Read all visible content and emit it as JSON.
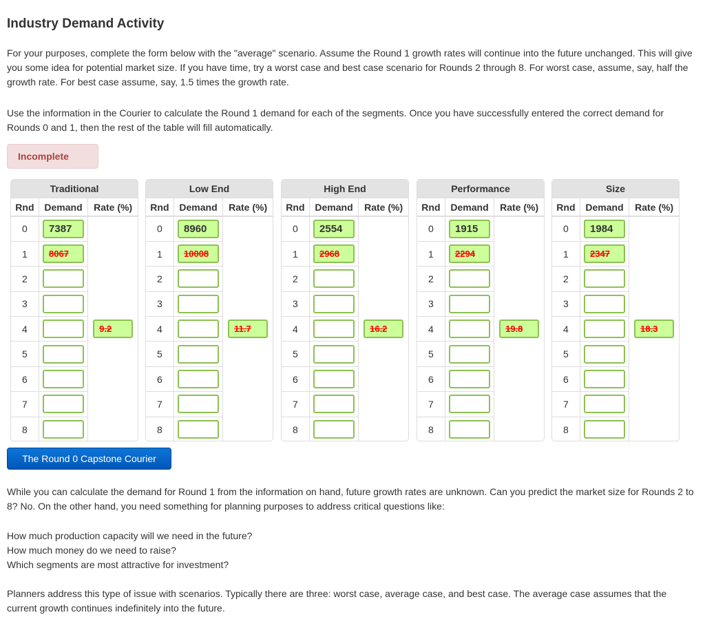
{
  "page": {
    "title": "Industry Demand Activity",
    "intro_paragraphs": [
      "For your purposes, complete the form below with the \"average\" scenario. Assume the Round 1 growth rates will continue into the future unchanged. This will give you some idea for potential market size. If you have time, try a worst case and best case scenario for Rounds 2 through 8. For worst case, assume, say, half the growth rate. For best case assume, say, 1.5 times the growth rate.",
      "Use the information in the Courier to calculate the Round 1 demand for each of the segments. Once you have successfully entered the correct demand for Rounds 0 and 1, then the rest of the table will fill automatically."
    ],
    "status": "Incomplete",
    "courier_button": "The Round 0 Capstone Courier",
    "after_paragraph": "While you can calculate the demand for Round 1 from the information on hand, future growth rates are unknown. Can you predict the market size for Rounds 2 to 8? No. On the other hand, you need something for planning purposes to address critical questions like:",
    "questions": [
      "How much production capacity will we need in the future?",
      "How much money do we need to raise?",
      "Which segments are most attractive for investment?"
    ],
    "closing_paragraph": "Planners address this type of issue with scenarios. Typically there are three: worst case, average case, and best case. The average case assumes that the current growth continues indefinitely into the future."
  },
  "table_headers": {
    "rnd": "Rnd",
    "demand": "Demand",
    "rate": "Rate (%)"
  },
  "colors": {
    "field_border": "#8cc152",
    "field_filled_bg": "#ccff99",
    "wrong_text": "#ff0000",
    "badge_bg": "#f2dede",
    "badge_text": "#a94442",
    "button_bg": "#0a6ad0"
  },
  "segments": [
    {
      "name": "Traditional",
      "rounds": [
        "0",
        "1",
        "2",
        "3",
        "4",
        "5",
        "6",
        "7",
        "8"
      ],
      "demand": [
        "7387",
        "8067",
        "",
        "",
        "",
        "",
        "",
        "",
        ""
      ],
      "rate": "9.2"
    },
    {
      "name": "Low End",
      "rounds": [
        "0",
        "1",
        "2",
        "3",
        "4",
        "5",
        "6",
        "7",
        "8"
      ],
      "demand": [
        "8960",
        "10008",
        "",
        "",
        "",
        "",
        "",
        "",
        ""
      ],
      "rate": "11.7"
    },
    {
      "name": "High End",
      "rounds": [
        "0",
        "1",
        "2",
        "3",
        "4",
        "5",
        "6",
        "7",
        "8"
      ],
      "demand": [
        "2554",
        "2968",
        "",
        "",
        "",
        "",
        "",
        "",
        ""
      ],
      "rate": "16.2"
    },
    {
      "name": "Performance",
      "rounds": [
        "0",
        "1",
        "2",
        "3",
        "4",
        "5",
        "6",
        "7",
        "8"
      ],
      "demand": [
        "1915",
        "2294",
        "",
        "",
        "",
        "",
        "",
        "",
        ""
      ],
      "rate": "19.8"
    },
    {
      "name": "Size",
      "rounds": [
        "0",
        "1",
        "2",
        "3",
        "4",
        "5",
        "6",
        "7",
        "8"
      ],
      "demand": [
        "1984",
        "2347",
        "",
        "",
        "",
        "",
        "",
        "",
        ""
      ],
      "rate": "18.3"
    }
  ]
}
